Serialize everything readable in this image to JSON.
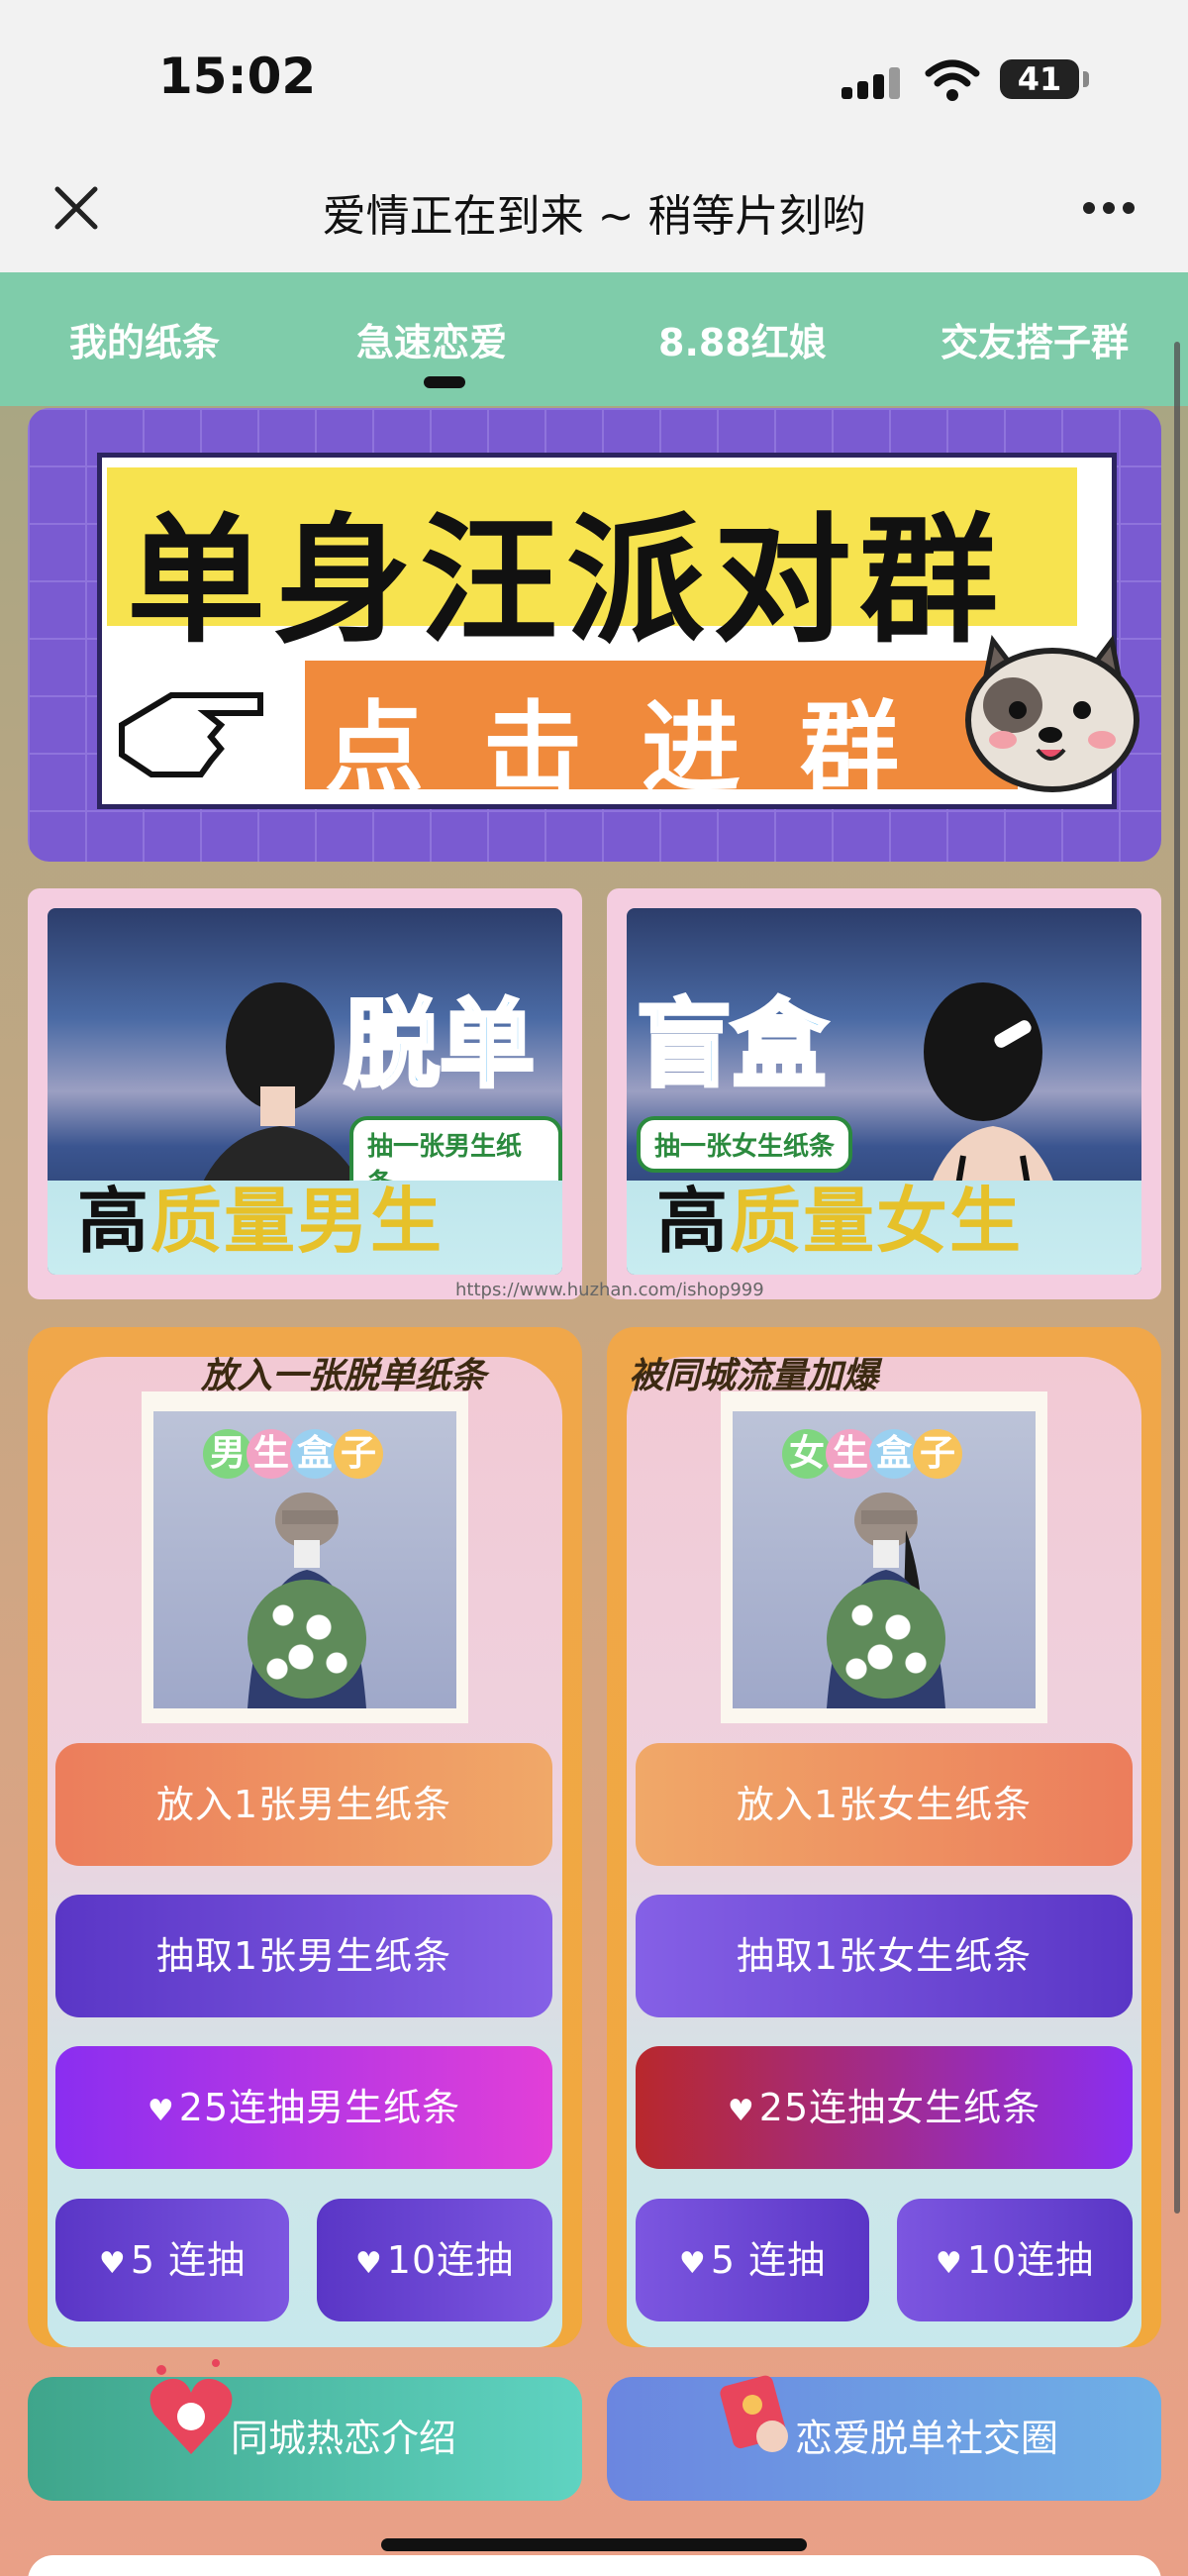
{
  "status": {
    "time": "15:02",
    "battery": "41"
  },
  "nav": {
    "title": "爱情正在到来 ~ 稍等片刻哟"
  },
  "tabs": [
    {
      "label": "我的纸条"
    },
    {
      "label": "急速恋爱"
    },
    {
      "label": "8.88红娘"
    },
    {
      "label": "交友搭子群"
    }
  ],
  "banner": {
    "title": "单身汪派对群",
    "action": "点击进群"
  },
  "cards": {
    "male": {
      "big": "脱单",
      "badge": "抽一张男生纸条",
      "headline_a": "高",
      "headline_b": "质量",
      "headline_c": "男生"
    },
    "female": {
      "big": "盲盒",
      "badge": "抽一张女生纸条",
      "headline_a": "高",
      "headline_b": "质量",
      "headline_c": "女生"
    }
  },
  "watermark": "https://www.huzhan.com/ishop999",
  "boxes": {
    "male": {
      "caption": "放入一张脱单纸条",
      "label": [
        "男",
        "生",
        "盒",
        "子"
      ],
      "put": "放入1张男生纸条",
      "draw": "抽取1张男生纸条",
      "draw25": "25连抽男生纸条",
      "draw5": "5 连抽",
      "draw10": "10连抽"
    },
    "female": {
      "caption": "被同城流量加爆",
      "label": [
        "女",
        "生",
        "盒",
        "子"
      ],
      "put": "放入1张女生纸条",
      "draw": "抽取1张女生纸条",
      "draw25": "25连抽女生纸条",
      "draw5": "5 连抽",
      "draw10": "10连抽"
    }
  },
  "bottom": {
    "left": "同城热恋介绍",
    "right": "恋爱脱单社交圈"
  },
  "colors": {
    "tab_bg": "#7fccaa",
    "banner_bg": "#7a5bd1",
    "orange_btn": "#ec8a5e",
    "purple_btn": "#6a48d8",
    "magenta_btn": "#c23ee8",
    "red_btn": "#b8282c"
  }
}
